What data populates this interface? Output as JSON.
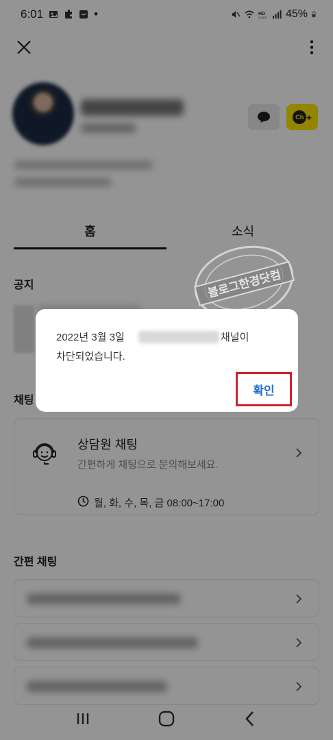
{
  "status": {
    "time": "6:01",
    "dot": "•",
    "battery": "45%"
  },
  "tabs": [
    {
      "label": "홈"
    },
    {
      "label": "소식"
    }
  ],
  "sections": {
    "notice": "공지",
    "chatting": "채팅",
    "quick_chat": "간편 채팅"
  },
  "counselor": {
    "title": "상담원 채팅",
    "description": "간편하게 채팅으로 문의해보세요.",
    "hours": "월, 화, 수, 목, 금 08:00~17:00"
  },
  "dialog": {
    "line1_prefix": "2022년 3월 3일",
    "line1_suffix": "채널이",
    "line2": "차단되었습니다.",
    "confirm_label": "확인"
  },
  "profile": {
    "channel_badge": "Ch",
    "channel_badge_plus": "+"
  },
  "watermark": {
    "text": "블로그한경닷컴"
  },
  "colors": {
    "accent_blue": "#1f6fd1",
    "highlight_red": "#d1222b",
    "kakao_yellow": "#fee500"
  }
}
